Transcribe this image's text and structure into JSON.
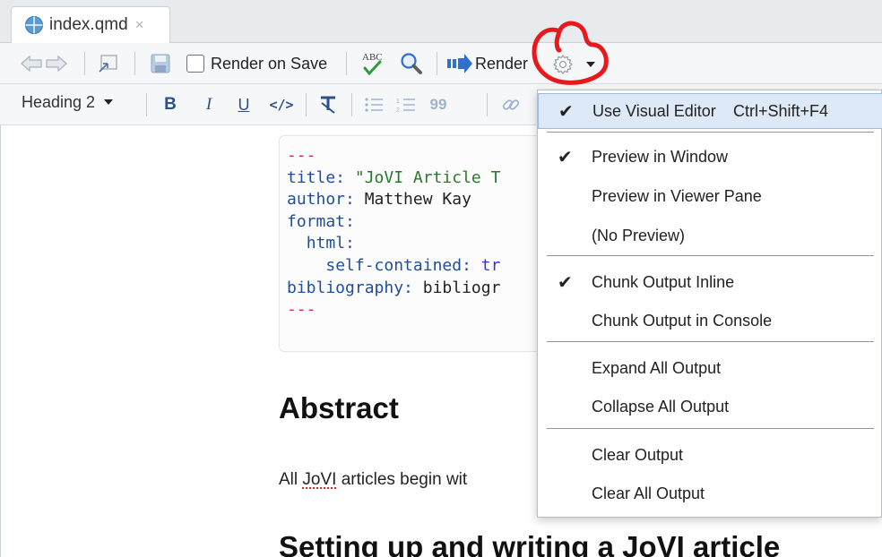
{
  "tab": {
    "title": "index.qmd",
    "close_glyph": "×",
    "icon": "quarto-doc-icon"
  },
  "toolbar": {
    "render_on_save_label": "Render on Save",
    "render_on_save_checked": false,
    "spellcheck_text": "ABC",
    "render_label": "Render",
    "icons": [
      "back-arrow-icon",
      "forward-arrow-icon",
      "show-in-window-icon",
      "save-icon",
      "spellcheck-icon",
      "search-icon",
      "render-arrow-icon",
      "gear-icon",
      "chevron-down-icon"
    ]
  },
  "format_bar": {
    "block_format": "Heading 2",
    "bold": "B",
    "italic": "I",
    "underline": "U",
    "code": "</>",
    "blockquote": "99"
  },
  "yaml": {
    "dashes_open": "---",
    "title_key": "title:",
    "title_value": "\"JoVI Article T",
    "author_key": "author:",
    "author_value": "Matthew Kay",
    "format_key": "format:",
    "html_key": "html:",
    "self_contained_key": "self-contained:",
    "self_contained_value": "tr",
    "bibliography_key": "bibliography:",
    "bibliography_value": "bibliogr",
    "dashes_close": "---"
  },
  "document": {
    "heading_abstract": "Abstract",
    "para_before": "All ",
    "para_misspelled": "JoVI",
    "para_after": " articles begin wit",
    "heading_setup": "Setting up and writing a JoVI article"
  },
  "menu": {
    "items": [
      {
        "label": "Use Visual Editor",
        "shortcut": "Ctrl+Shift+F4",
        "checked": true,
        "highlighted": true
      },
      {
        "label": "Preview in Window",
        "checked": true
      },
      {
        "label": "Preview in Viewer Pane",
        "checked": false
      },
      {
        "label": "(No Preview)",
        "checked": false
      },
      {
        "label": "Chunk Output Inline",
        "checked": true
      },
      {
        "label": "Chunk Output in Console",
        "checked": false
      },
      {
        "label": "Expand All Output",
        "checked": false
      },
      {
        "label": "Collapse All Output",
        "checked": false
      },
      {
        "label": "Clear Output",
        "checked": false
      },
      {
        "label": "Clear All Output",
        "checked": false
      }
    ],
    "check_glyph": "✔"
  },
  "colors": {
    "annotation": "#e8191c",
    "menu_highlight": "#dde9f6",
    "yaml_key": "#1f4e9b",
    "yaml_string": "#257a2c",
    "yaml_dash": "#c0307a",
    "render_arrow": "#2f6fd0"
  }
}
